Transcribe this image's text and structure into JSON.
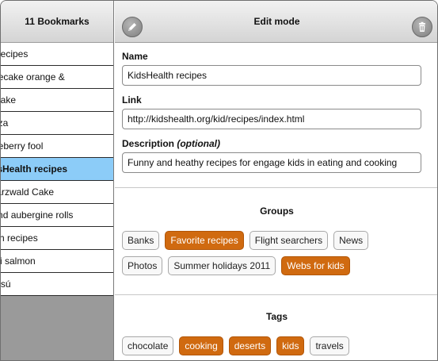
{
  "sidebar": {
    "title": "11 Bookmarks",
    "items": [
      {
        "label": "Recipes",
        "selected": false
      },
      {
        "label": "Cheesecake orange &",
        "selected": false
      },
      {
        "label": "Cake",
        "selected": false
      },
      {
        "label": "Pizza",
        "selected": false
      },
      {
        "label": "Gooseberry fool",
        "selected": false
      },
      {
        "label": "KidsHealth recipes",
        "selected": true
      },
      {
        "label": "Schwarzwald Cake",
        "selected": false
      },
      {
        "label": "Lamb and aubergine rolls",
        "selected": false
      },
      {
        "label": "Fish recipes",
        "selected": false
      },
      {
        "label": "Teriyaki salmon",
        "selected": false
      },
      {
        "label": "Tiramisú",
        "selected": false
      }
    ]
  },
  "header": {
    "title": "Edit mode",
    "left_icon": "pencil-icon",
    "right_icon": "trash-icon"
  },
  "form": {
    "name_label": "Name",
    "name_value": "KidsHealth recipes",
    "link_label": "Link",
    "link_value": "http://kidshealth.org/kid/recipes/index.html",
    "description_label": "Description",
    "description_optional": "(optional)",
    "description_value": "Funny and heathy recipes for engage kids in eating and cooking"
  },
  "groups": {
    "title": "Groups",
    "items": [
      {
        "label": "Banks",
        "active": false
      },
      {
        "label": "Favorite recipes",
        "active": true
      },
      {
        "label": "Flight searchers",
        "active": false
      },
      {
        "label": "News",
        "active": false
      },
      {
        "label": "Photos",
        "active": false
      },
      {
        "label": "Summer holidays 2011",
        "active": false
      },
      {
        "label": "Webs for kids",
        "active": true
      }
    ]
  },
  "tags": {
    "title": "Tags",
    "items": [
      {
        "label": "chocolate",
        "active": false
      },
      {
        "label": "cooking",
        "active": true
      },
      {
        "label": "deserts",
        "active": true
      },
      {
        "label": "kids",
        "active": true
      },
      {
        "label": "travels",
        "active": false
      }
    ]
  },
  "colors": {
    "selected_row": "#8cccf8",
    "active_chip": "#d06a10"
  }
}
